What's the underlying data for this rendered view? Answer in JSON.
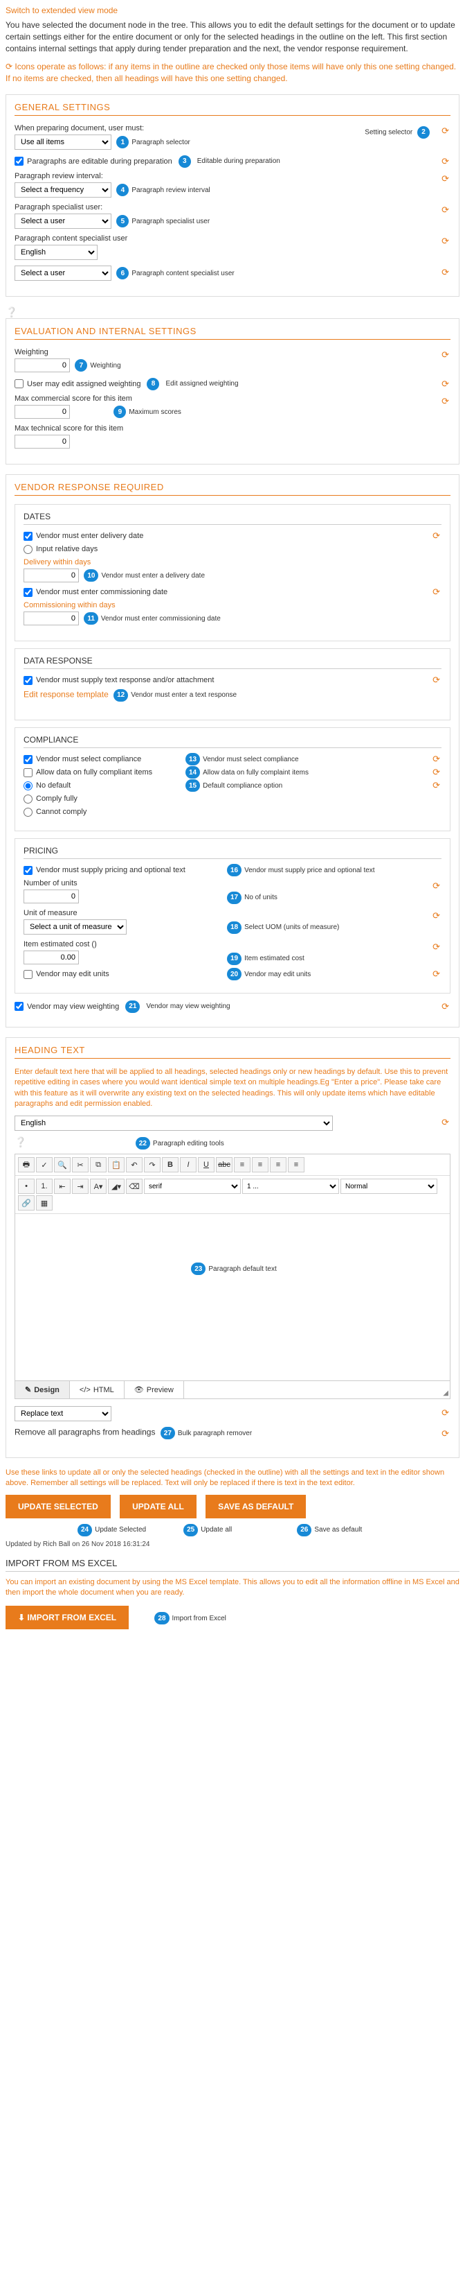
{
  "top": {
    "switch_link": "Switch to extended view mode",
    "intro": "You have selected the document node in the tree. This allows you to edit the default settings for the document or to update certain settings either for the entire document or only for the selected headings in the outline on the left. This first section contains internal settings that apply during tender preparation and the next, the vendor response requirement.",
    "icons_note": "Icons operate as follows: if any items in the outline are checked only those items will have only this one setting changed. If no items are checked, then all headings will have this one setting changed."
  },
  "general": {
    "title": "GENERAL SETTINGS",
    "prep_label": "When preparing document, user must:",
    "prep_select": "Use all items",
    "badge1": "Paragraph selector",
    "setting_selector": "Setting selector",
    "editable_label": "Paragraphs are editable during preparation",
    "badge3": "Editable during preparation",
    "review_label": "Paragraph review interval:",
    "review_select": "Select a frequency",
    "badge4": "Paragraph review interval",
    "specialist_label": "Paragraph specialist user:",
    "specialist_select": "Select a user",
    "badge5": "Paragraph specialist user",
    "content_label": "Paragraph content specialist user",
    "lang_select": "English",
    "content_select": "Select a user",
    "badge6": "Paragraph content specialist user"
  },
  "evaluation": {
    "title": "EVALUATION AND INTERNAL SETTINGS",
    "weighting_label": "Weighting",
    "weighting_val": "0",
    "badge7": "Weighting",
    "user_edit_label": "User may edit assigned weighting",
    "badge8": "Edit assigned weighting",
    "max_comm_label": "Max commercial score for this item",
    "max_comm_val": "0",
    "badge9": "Maximum scores",
    "max_tech_label": "Max technical score for this item",
    "max_tech_val": "0"
  },
  "vendor": {
    "title": "VENDOR RESPONSE REQUIRED",
    "dates": {
      "title": "DATES",
      "delivery_cb": "Vendor must enter delivery date",
      "relative_cb": "Input relative days",
      "delivery_within": "Delivery within days",
      "delivery_val": "0",
      "badge10": "Vendor must enter a delivery date",
      "commission_cb": "Vendor must enter commissioning date",
      "commission_within": "Commissioning within days",
      "commission_val": "0",
      "badge11": "Vendor must enter commissioning date"
    },
    "data_response": {
      "title": "DATA RESPONSE",
      "supply_cb": "Vendor must supply text response and/or attachment",
      "edit_template": "Edit response template",
      "badge12": "Vendor must enter a text response"
    },
    "compliance": {
      "title": "COMPLIANCE",
      "select_cb": "Vendor must select compliance",
      "badge13": "Vendor must select compliance",
      "allow_cb": "Allow data on fully compliant items",
      "badge14": "Allow data on fully complaint items",
      "no_default": "No default",
      "badge15": "Default compliance option",
      "comply_fully": "Comply fully",
      "cannot_comply": "Cannot comply"
    },
    "pricing": {
      "title": "PRICING",
      "supply_cb": "Vendor must supply pricing and optional text",
      "badge16": "Vendor must supply price and optional text",
      "units_label": "Number of units",
      "units_val": "0",
      "badge17": "No of units",
      "uom_label": "Unit of measure",
      "uom_select": "Select a unit of measure",
      "badge18": "Select UOM (units of measure)",
      "est_label": "Item estimated cost ()",
      "est_val": "0.00",
      "badge19": "Item estimated cost",
      "edit_units_cb": "Vendor may edit units",
      "badge20": "Vendor may edit units"
    },
    "view_weight_cb": "Vendor may view weighting",
    "badge21": "Vendor may view weighting"
  },
  "heading_text": {
    "title": "HEADING TEXT",
    "intro": "Enter default text here that will be applied to all headings, selected headings only or new headings by default. Use this to prevent repetitive editing in cases where you would want identical simple text on multiple headings.Eg \"Enter a price\". Please take care with this feature as it will overwrite any existing text on the selected headings. This will only update items which have editable paragraphs and edit permission enabled.",
    "lang_select": "English",
    "badge22": "Paragraph editing tools",
    "badge23": "Paragraph default text",
    "tab_design": "Design",
    "tab_html": "HTML",
    "tab_preview": "Preview",
    "replace_select": "Replace text",
    "remove_label": "Remove all paragraphs from headings",
    "badge27": "Bulk paragraph remover",
    "toolbar": {
      "serif": "serif",
      "size": "1 ...",
      "normal": "Normal"
    }
  },
  "bottom": {
    "note": "Use these links to update all or only the selected headings (checked in the outline) with all the settings and text in the editor shown above. Remember all settings will be replaced. Text will only be replaced if there is text in the text editor.",
    "btn_update_selected": "UPDATE SELECTED",
    "btn_update_all": "UPDATE ALL",
    "btn_save_default": "SAVE AS DEFAULT",
    "badge24": "Update Selected",
    "badge25": "Update all",
    "badge26": "Save as default",
    "updated": "Updated by Rich Ball on 26 Nov 2018 16:31:24"
  },
  "import": {
    "title": "IMPORT FROM MS EXCEL",
    "text": "You can import an existing document by using the MS Excel template. This allows you to edit all the information offline in MS Excel and then import the whole document when you are ready.",
    "btn": "IMPORT FROM EXCEL",
    "badge28": "Import from Excel"
  }
}
